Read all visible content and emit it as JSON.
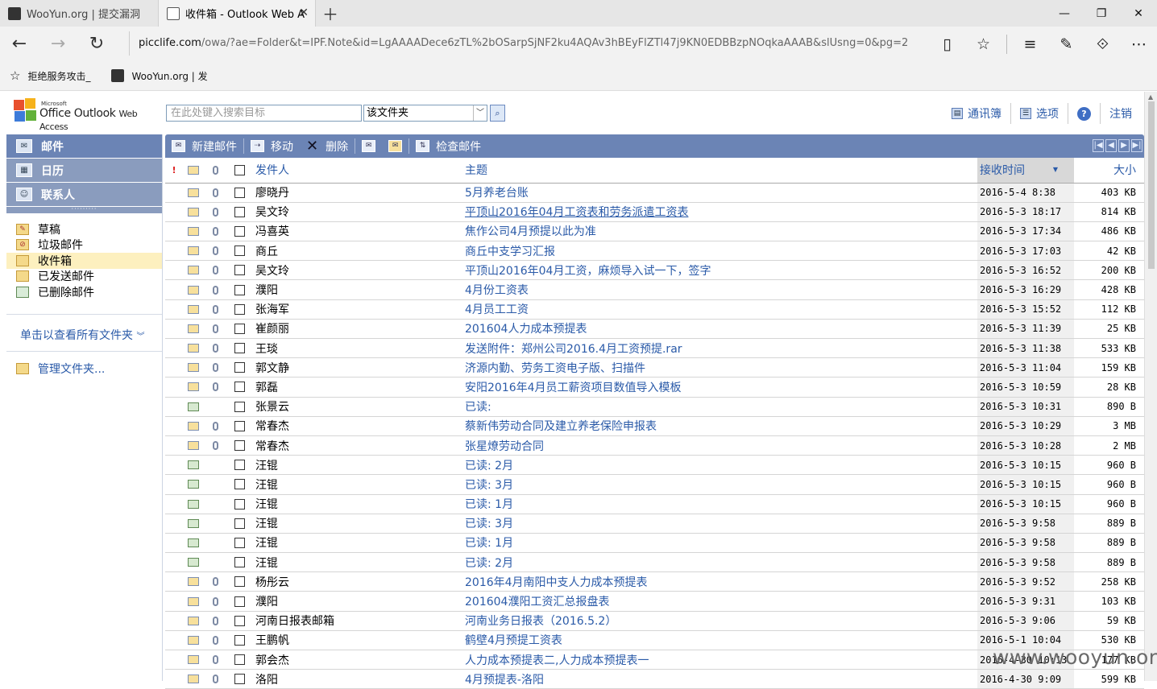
{
  "browser": {
    "tabs": [
      {
        "title": "WooYun.org | 提交漏洞",
        "active": false
      },
      {
        "title": "收件箱 - Outlook Web A",
        "active": true
      }
    ],
    "address_host": "picclife.com",
    "address_path": "/owa/?ae=Folder&t=IPF.Note&id=LgAAAADece6zTL%2bOSarpSjNF2ku4AQAv3hBEyFlZTl47j9KN0EDBBzpNOqkaAAAB&slUsng=0&pg=2",
    "favorites": [
      "拒绝服务攻击_",
      "WooYun.org | 发"
    ]
  },
  "owa": {
    "logo_microsoft": "Microsoft",
    "logo_office": "Office Outlook",
    "logo_webaccess": "Web Access",
    "search_placeholder": "在此处键入搜索目标",
    "search_scope": "该文件夹",
    "toplinks": {
      "contacts": "通讯簿",
      "options": "选项",
      "signout": "注销"
    },
    "nav": [
      "邮件",
      "日历",
      "联系人"
    ],
    "folders": [
      "草稿",
      "垃圾邮件",
      "收件箱",
      "已发送邮件",
      "已删除邮件"
    ],
    "selected_folder": "收件箱",
    "all_folders_link": "单击以查看所有文件夹",
    "manage_folders": "管理文件夹...",
    "toolbar": {
      "new_mail": "新建邮件",
      "move": "移动",
      "delete": "删除",
      "check_mail": "检查邮件"
    },
    "columns": {
      "from": "发件人",
      "subject": "主题",
      "received": "接收时间",
      "size": "大小"
    }
  },
  "messages": [
    {
      "from": "廖晓丹",
      "subject": "5月养老台账",
      "date": "2016-5-4 8:38",
      "size": "403 KB",
      "attach": true,
      "read_receipt": false,
      "u": false
    },
    {
      "from": "吴文玲",
      "subject": "平顶山2016年04月工资表和劳务派遣工资表",
      "date": "2016-5-3 18:17",
      "size": "814 KB",
      "attach": true,
      "read_receipt": false,
      "u": true
    },
    {
      "from": "冯喜英",
      "subject": "焦作公司4月预提以此为准",
      "date": "2016-5-3 17:34",
      "size": "486 KB",
      "attach": true,
      "read_receipt": false,
      "u": false
    },
    {
      "from": "商丘",
      "subject": "商丘中支学习汇报",
      "date": "2016-5-3 17:03",
      "size": "42 KB",
      "attach": true,
      "read_receipt": false,
      "u": false
    },
    {
      "from": "吴文玲",
      "subject": "平顶山2016年04月工资，麻烦导入试一下，签字",
      "date": "2016-5-3 16:52",
      "size": "200 KB",
      "attach": true,
      "read_receipt": false,
      "u": false
    },
    {
      "from": "濮阳",
      "subject": "4月份工资表",
      "date": "2016-5-3 16:29",
      "size": "428 KB",
      "attach": true,
      "read_receipt": false,
      "u": false
    },
    {
      "from": "张海军",
      "subject": "4月员工工资",
      "date": "2016-5-3 15:52",
      "size": "112 KB",
      "attach": true,
      "read_receipt": false,
      "u": false
    },
    {
      "from": "崔颜丽",
      "subject": "201604人力成本预提表",
      "date": "2016-5-3 11:39",
      "size": "25 KB",
      "attach": true,
      "read_receipt": false,
      "u": false
    },
    {
      "from": "王琰",
      "subject": "发送附件：郑州公司2016.4月工资预提.rar",
      "date": "2016-5-3 11:38",
      "size": "533 KB",
      "attach": true,
      "read_receipt": false,
      "u": false
    },
    {
      "from": "郭文静",
      "subject": "济源内勤、劳务工资电子版、扫描件",
      "date": "2016-5-3 11:04",
      "size": "159 KB",
      "attach": true,
      "read_receipt": false,
      "u": false
    },
    {
      "from": "郭磊",
      "subject": "安阳2016年4月员工薪资项目数值导入模板",
      "date": "2016-5-3 10:59",
      "size": "28 KB",
      "attach": true,
      "read_receipt": false,
      "u": false
    },
    {
      "from": "张景云",
      "subject": "已读:",
      "date": "2016-5-3 10:31",
      "size": "890 B",
      "attach": false,
      "read_receipt": true,
      "u": false
    },
    {
      "from": "常春杰",
      "subject": "蔡新伟劳动合同及建立养老保险申报表",
      "date": "2016-5-3 10:29",
      "size": "3 MB",
      "attach": true,
      "read_receipt": false,
      "u": false
    },
    {
      "from": "常春杰",
      "subject": "张星燎劳动合同",
      "date": "2016-5-3 10:28",
      "size": "2 MB",
      "attach": true,
      "read_receipt": false,
      "u": false
    },
    {
      "from": "汪锟",
      "subject": "已读: 2月",
      "date": "2016-5-3 10:15",
      "size": "960 B",
      "attach": false,
      "read_receipt": true,
      "u": false
    },
    {
      "from": "汪锟",
      "subject": "已读: 3月",
      "date": "2016-5-3 10:15",
      "size": "960 B",
      "attach": false,
      "read_receipt": true,
      "u": false
    },
    {
      "from": "汪锟",
      "subject": "已读: 1月",
      "date": "2016-5-3 10:15",
      "size": "960 B",
      "attach": false,
      "read_receipt": true,
      "u": false
    },
    {
      "from": "汪锟",
      "subject": "已读: 3月",
      "date": "2016-5-3 9:58",
      "size": "889 B",
      "attach": false,
      "read_receipt": true,
      "u": false
    },
    {
      "from": "汪锟",
      "subject": "已读: 1月",
      "date": "2016-5-3 9:58",
      "size": "889 B",
      "attach": false,
      "read_receipt": true,
      "u": false
    },
    {
      "from": "汪锟",
      "subject": "已读: 2月",
      "date": "2016-5-3 9:58",
      "size": "889 B",
      "attach": false,
      "read_receipt": true,
      "u": false
    },
    {
      "from": "杨彤云",
      "subject": "2016年4月南阳中支人力成本预提表",
      "date": "2016-5-3 9:52",
      "size": "258 KB",
      "attach": true,
      "read_receipt": false,
      "u": false
    },
    {
      "from": "濮阳",
      "subject": "201604濮阳工资汇总报盘表",
      "date": "2016-5-3 9:31",
      "size": "103 KB",
      "attach": true,
      "read_receipt": false,
      "u": false
    },
    {
      "from": "河南日报表邮箱",
      "subject": "河南业务日报表（2016.5.2）",
      "date": "2016-5-3 9:06",
      "size": "59 KB",
      "attach": true,
      "read_receipt": false,
      "u": false
    },
    {
      "from": "王鹏帆",
      "subject": "鹤壁4月预提工资表",
      "date": "2016-5-1 10:04",
      "size": "530 KB",
      "attach": true,
      "read_receipt": false,
      "u": false
    },
    {
      "from": "郭会杰",
      "subject": "人力成本预提表二,人力成本预提表一",
      "date": "2016-4-30 10:13",
      "size": "177 KB",
      "attach": true,
      "read_receipt": false,
      "u": false
    },
    {
      "from": "洛阳",
      "subject": "4月预提表-洛阳",
      "date": "2016-4-30 9:09",
      "size": "599 KB",
      "attach": true,
      "read_receipt": false,
      "u": false
    }
  ],
  "watermark": "www.wooyun.org"
}
